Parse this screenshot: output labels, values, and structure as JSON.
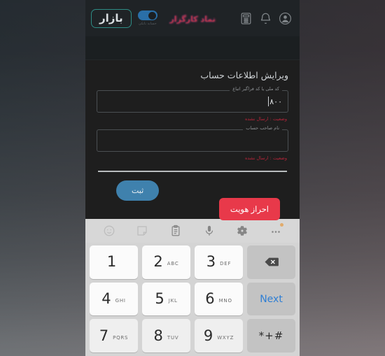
{
  "app": {
    "header": {
      "logo_label": "بازار",
      "toggle_caption": "حسابه بانکی",
      "toggle_state": "on",
      "brand_text": "نماد کارگزار",
      "icons": [
        {
          "name": "calculator-icon"
        },
        {
          "name": "bell-icon"
        },
        {
          "name": "account-avatar-icon"
        }
      ]
    },
    "form": {
      "title": "ویرایش اطلاعات حساب",
      "fields": [
        {
          "legend": "کد ملی یا کد فراگیر اتباع",
          "value": "۸۰۰",
          "status": "وضعیت : ارسال نشده",
          "focused": true
        },
        {
          "legend": "نام صاحب حساب",
          "value": "",
          "status": "وضعیت : ارسال نشده",
          "focused": false
        }
      ],
      "submit_label": "ثبت",
      "verify_label": "احراز هویت"
    }
  },
  "keyboard": {
    "toolbar": [
      {
        "name": "emoji-icon",
        "dim": true
      },
      {
        "name": "sticker-icon",
        "dim": true
      },
      {
        "name": "clipboard-icon",
        "dim": false
      },
      {
        "name": "microphone-icon",
        "dim": false
      },
      {
        "name": "settings-gear-icon",
        "dim": false
      },
      {
        "name": "more-options-icon",
        "dim": false,
        "badge": true
      }
    ],
    "rows": [
      [
        {
          "num": "1",
          "sub": ""
        },
        {
          "num": "2",
          "sub": "ABC"
        },
        {
          "num": "3",
          "sub": "DEF"
        },
        {
          "type": "backspace",
          "label": ""
        }
      ],
      [
        {
          "num": "4",
          "sub": "GHI"
        },
        {
          "num": "5",
          "sub": "JKL"
        },
        {
          "num": "6",
          "sub": "MNO"
        },
        {
          "type": "action",
          "label": "Next"
        }
      ],
      [
        {
          "num": "7",
          "sub": "PQRS"
        },
        {
          "num": "8",
          "sub": "TUV"
        },
        {
          "num": "9",
          "sub": "WXYZ"
        },
        {
          "type": "symbols",
          "label": "*+#"
        }
      ]
    ]
  },
  "colors": {
    "accent_teal": "#2e8b84",
    "accent_blue": "#3f81ad",
    "accent_red": "#e8394a",
    "status_red": "#b5253a",
    "toggle_blue": "#2a6fa8",
    "key_blue": "#2f7fd4"
  }
}
